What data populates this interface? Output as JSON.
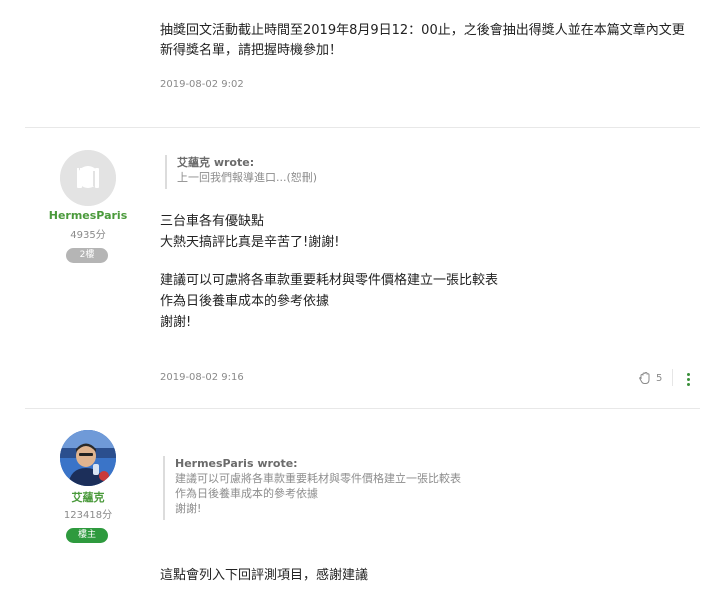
{
  "post1": {
    "line1": "抽獎回文活動截止時間至2019年8月9日12：00止，之後會抽出得獎人並在本篇文章內文更",
    "line2": "新得獎名單，請把握時機參加！",
    "timestamp": "2019-08-02 9:02"
  },
  "post2": {
    "user": {
      "name": "HermesParis",
      "score": "4935分",
      "floor_badge": "2樓"
    },
    "quote": {
      "author": "艾蘊克 wrote:",
      "lines": [
        "上一回我們報導進口...(恕刪)"
      ]
    },
    "body": [
      "三台車各有優缺點",
      "大熱天搞評比真是辛苦了!謝謝!",
      "",
      "建議可以可慮將各車款重要耗材與零件價格建立一張比較表",
      "作為日後養車成本的參考依據",
      "謝謝!"
    ],
    "timestamp": "2019-08-02 9:16",
    "like_count": "5"
  },
  "post3": {
    "user": {
      "name": "艾蘊克",
      "score": "123418分",
      "role_badge": "樓主"
    },
    "quote": {
      "author": "HermesParis wrote:",
      "lines": [
        "建議可以可慮將各車款重要耗材與零件價格建立一張比較表",
        "作為日後養車成本的參考依據",
        "謝謝!"
      ]
    },
    "body": [
      "這點會列入下回評測項目，感謝建議"
    ]
  },
  "colors": {
    "username_green": "#4a9a3b",
    "op_badge": "#2e9a3e",
    "floor_badge": "#b5b5b5"
  }
}
